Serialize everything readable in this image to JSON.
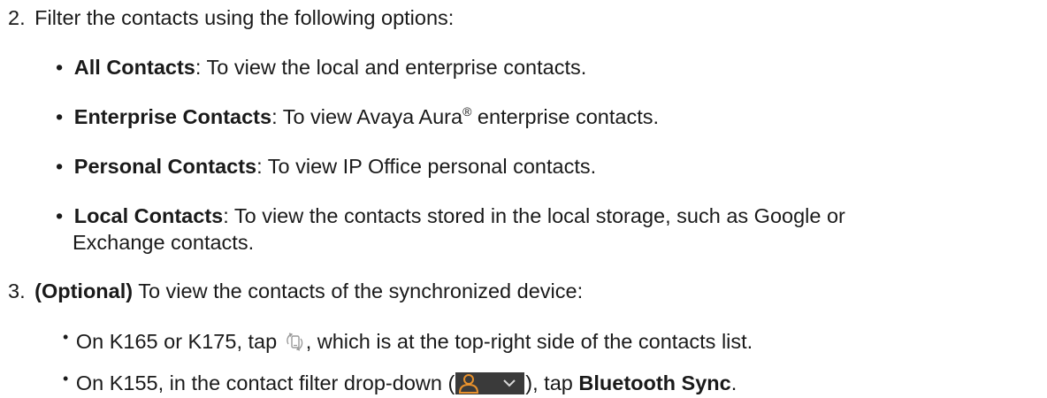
{
  "steps": [
    {
      "number": "2.",
      "text": "Filter the contacts using the following options:",
      "options": [
        {
          "term": "All Contacts",
          "desc": ": To view the local and enterprise contacts."
        },
        {
          "term": "Enterprise Contacts",
          "desc_before": ": To view Avaya Aura",
          "sup": "®",
          "desc_after": " enterprise contacts."
        },
        {
          "term": "Personal Contacts",
          "desc": ": To view IP Office personal contacts."
        },
        {
          "term": "Local Contacts",
          "desc": ": To view the contacts stored in the local storage, such as Google or",
          "desc_cont": "Exchange contacts."
        }
      ]
    },
    {
      "number": "3.",
      "prefix_bold": "(Optional)",
      "text": " To view the contacts of the synchronized device:",
      "subitems": [
        {
          "before_icon": "On K165 or K175, tap ",
          "icon": "sync-device-icon",
          "after_icon": ", which is at the top-right side of the contacts list."
        },
        {
          "before_widget": "On K155, in the contact filter drop-down (",
          "widget": "contact-filter-dropdown",
          "after_widget": "), tap ",
          "bold": "Bluetooth Sync",
          "end": "."
        }
      ]
    }
  ],
  "colors": {
    "text": "#1a1a1a",
    "widget_bg": "#3a3a3a",
    "widget_accent": "#e8912c",
    "icon_gray": "#9a9a9a"
  }
}
